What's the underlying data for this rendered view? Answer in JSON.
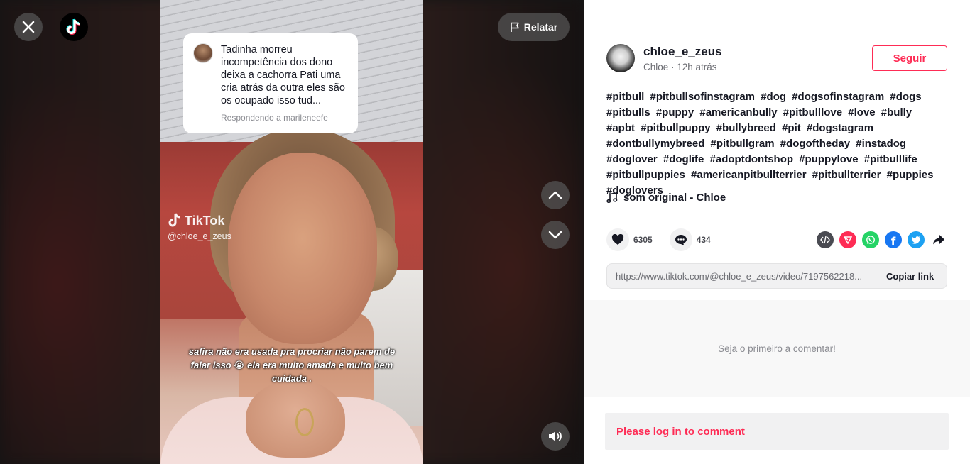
{
  "player": {
    "report_label": "Relatar",
    "pinned_comment": {
      "text": "Tadinha morreu incompetência dos dono deixa a cachorra Pati uma cria atrás da outra eles são os ocupado isso tud...",
      "reply_label": "Respondendo a marileneefe"
    },
    "watermark": {
      "brand": "TikTok",
      "handle": "@chloe_e_zeus"
    },
    "caption": "safira não era usada pra procriar não parem de falar isso 😭 ela era muito amada e muito bem cuidada ."
  },
  "author": {
    "username": "chloe_e_zeus",
    "subtitle": "Chloe · 12h atrás",
    "follow_label": "Seguir"
  },
  "description": {
    "hashtags": [
      "#pitbull",
      "#pitbullsofinstagram",
      "#dog",
      "#dogsofinstagram",
      "#dogs",
      "#pitbulls",
      "#puppy",
      "#americanbully",
      "#pitbulllove",
      "#love",
      "#bully",
      "#apbt",
      "#pitbullpuppy",
      "#bullybreed",
      "#pit",
      "#dogstagram",
      "#dontbullymybreed",
      "#pitbullgram",
      "#dogoftheday",
      "#instadog",
      "#doglover",
      "#doglife",
      "#adoptdontshop",
      "#puppylove",
      "#pitbulllife",
      "#pitbullpuppies",
      "#americanpitbullterrier",
      "#pitbullterrier",
      "#puppies",
      "#doglovers"
    ]
  },
  "music": "som original - Chloe",
  "stats": {
    "likes": "6305",
    "comments": "434"
  },
  "share": {
    "icons": [
      "embed-icon",
      "send-icon",
      "whatsapp-icon",
      "facebook-icon",
      "twitter-icon",
      "share-arrow-icon"
    ],
    "link": "https://www.tiktok.com/@chloe_e_zeus/video/7197562218...",
    "copy_label": "Copiar link"
  },
  "comments": {
    "empty_text": "Seja o primeiro a comentar!",
    "login_prompt": "Please log in to comment"
  },
  "colors": {
    "accent": "#fe2c55",
    "whatsapp": "#25d366",
    "facebook": "#1877f2",
    "twitter": "#1da1f2",
    "embed": "#4a4b52"
  }
}
